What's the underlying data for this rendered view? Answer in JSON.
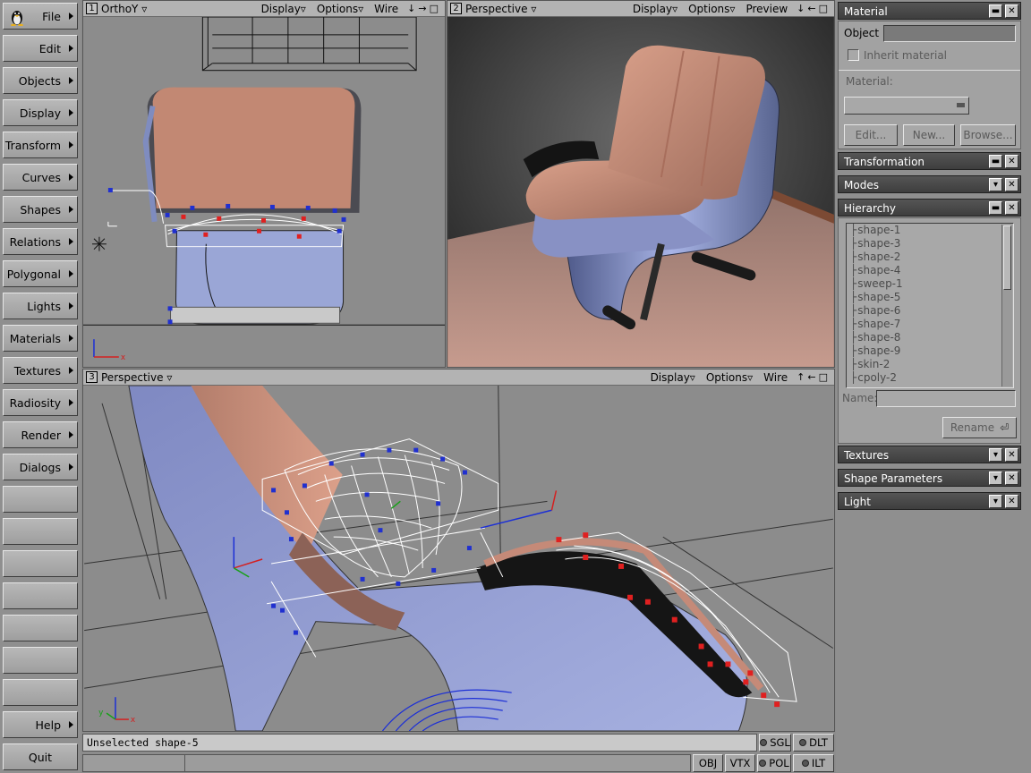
{
  "menu": {
    "items": [
      "File",
      "Edit",
      "Objects",
      "Display",
      "Transform",
      "Curves",
      "Shapes",
      "Relations",
      "Polygonal",
      "Lights",
      "Materials",
      "Textures",
      "Radiosity",
      "Render",
      "Dialogs"
    ],
    "help": "Help",
    "quit": "Quit"
  },
  "viewports": {
    "v1": {
      "num": "1",
      "title": "OrthoY",
      "display": "Display",
      "options": "Options",
      "mode": "Wire",
      "icons": "↓→□"
    },
    "v2": {
      "num": "2",
      "title": "Perspective",
      "display": "Display",
      "options": "Options",
      "mode": "Preview",
      "icons": "↓←□"
    },
    "v3": {
      "num": "3",
      "title": "Perspective",
      "display": "Display",
      "options": "Options",
      "mode": "Wire",
      "icons": "↑←□"
    }
  },
  "axis": {
    "x": "x",
    "y": "y"
  },
  "status": {
    "message": "Unselected shape-5",
    "sgl": "SGL",
    "dlt": "DLT",
    "obj": "OBJ",
    "vtx": "VTX",
    "pol": "POL",
    "ilt": "ILT"
  },
  "panel": {
    "material": {
      "title": "Material",
      "object_label": "Object",
      "inherit_label": "Inherit material",
      "material_label": "Material:",
      "edit": "Edit...",
      "new": "New...",
      "browse": "Browse..."
    },
    "transformation": "Transformation",
    "modes": "Modes",
    "hierarchy": {
      "title": "Hierarchy",
      "items": [
        "shape-1",
        "shape-3",
        "shape-2",
        "shape-4",
        "sweep-1",
        "shape-5",
        "shape-6",
        "shape-7",
        "shape-8",
        "shape-9",
        "skin-2",
        "cpoly-2"
      ],
      "name_label": "Name:",
      "rename": "Rename"
    },
    "textures": "Textures",
    "shape_parameters": "Shape Parameters",
    "light": "Light"
  }
}
